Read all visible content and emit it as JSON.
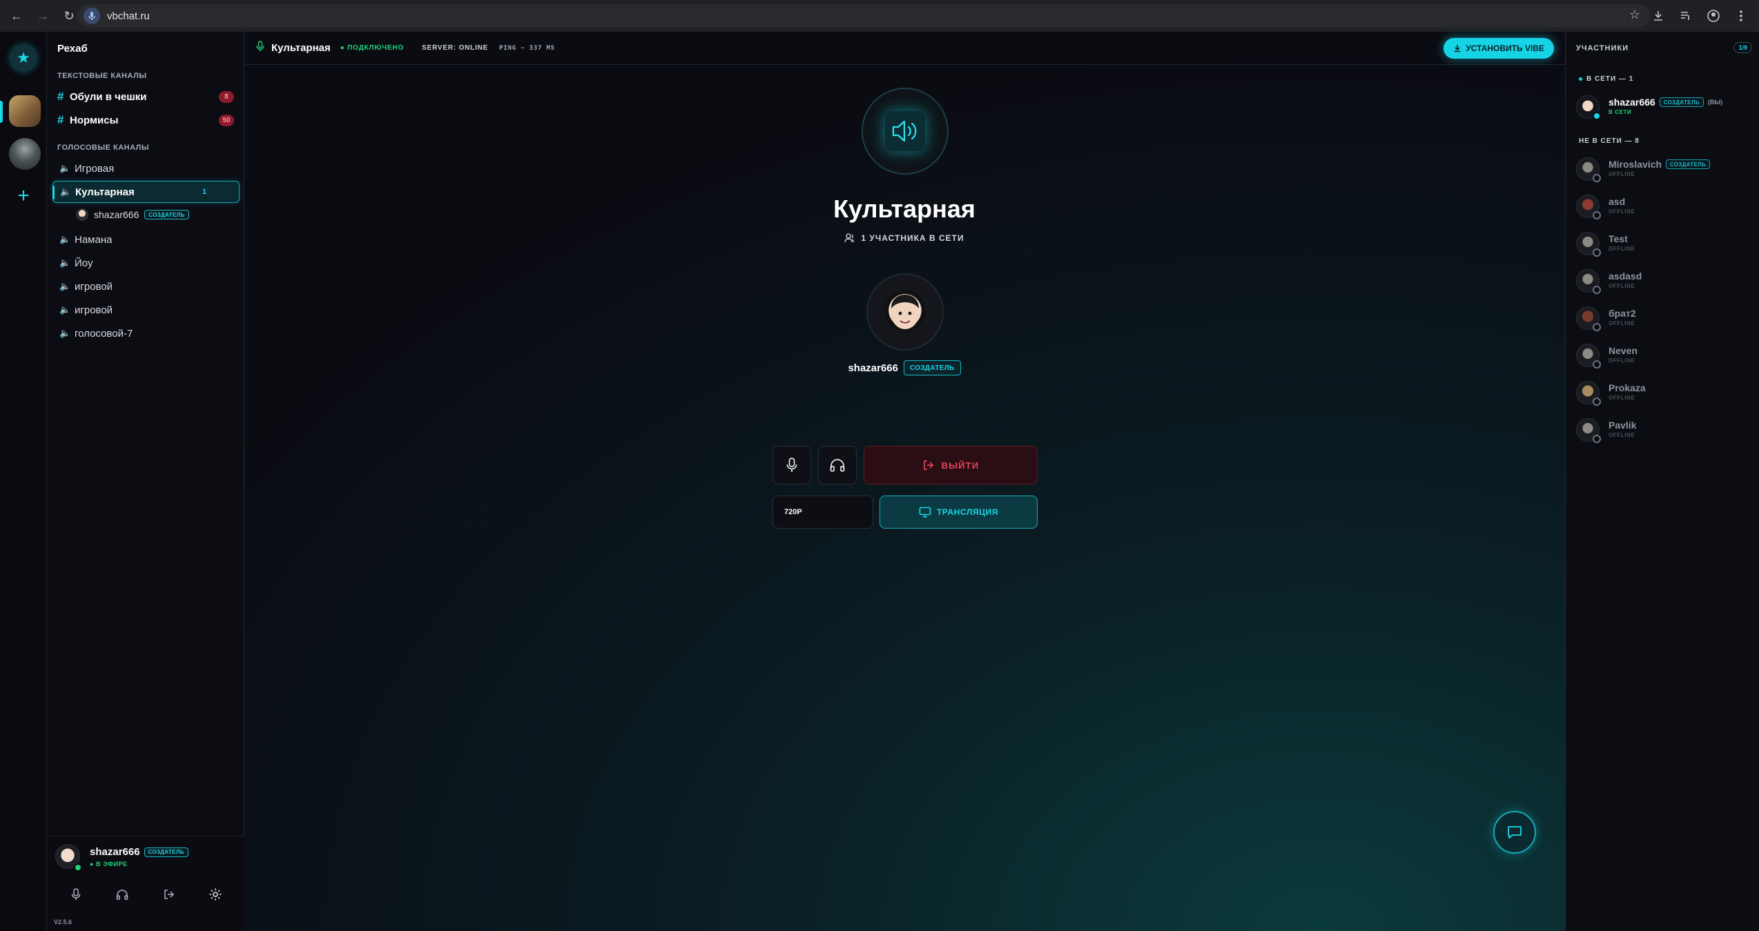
{
  "browser": {
    "url": "vbchat.ru"
  },
  "server": {
    "name": "Рехаб",
    "text_category": "ТЕКСТОВЫЕ КАНАЛЫ",
    "voice_category": "ГОЛОСОВЫЕ КАНАЛЫ",
    "text_channels": [
      {
        "name": "Обули в чешки",
        "unread": "8"
      },
      {
        "name": "Нормисы",
        "unread": "50"
      }
    ],
    "voice_channels": [
      {
        "name": "Игровая"
      },
      {
        "name": "Культарная",
        "count": "1"
      },
      {
        "name": "Намана"
      },
      {
        "name": "Йоу"
      },
      {
        "name": "игровой"
      },
      {
        "name": "игровой"
      },
      {
        "name": "голосовой-7"
      }
    ],
    "voice_member": {
      "name": "shazar666",
      "tag": "СОЗДАТЕЛЬ"
    }
  },
  "user_panel": {
    "name": "shazar666",
    "tag": "СОЗДАТЕЛЬ",
    "status": "● В ЭФИРЕ",
    "version": "V2.5.6"
  },
  "topbar": {
    "channel": "Культарная",
    "connection": "● ПОДКЛЮЧЕНО",
    "server_status": "SERVER: ONLINE",
    "ping": "PING ~ 337 MS",
    "install_label": "УСТАНОВИТЬ VIBE"
  },
  "room": {
    "title": "Культарная",
    "online": "1 УЧАСТНИКА В СЕТИ",
    "participant": {
      "name": "shazar666",
      "tag": "СОЗДАТЕЛЬ"
    },
    "exit_label": "ВЫЙТИ",
    "resolution": "720P",
    "stream_label": "ТРАНСЛЯЦИЯ"
  },
  "members": {
    "title": "УЧАСТНИКИ",
    "count": "1/9",
    "online_header": "В СЕТИ — 1",
    "offline_header": "НЕ В СЕТИ — 8",
    "online": [
      {
        "name": "shazar666",
        "tag": "СОЗДАТЕЛЬ",
        "you": "(ВЫ)",
        "status": "В СЕТИ"
      }
    ],
    "offline": [
      {
        "name": "Miroslavich",
        "tag": "СОЗДАТЕЛЬ",
        "status": "OFFLINE"
      },
      {
        "name": "asd",
        "status": "OFFLINE"
      },
      {
        "name": "Test",
        "status": "OFFLINE"
      },
      {
        "name": "asdasd",
        "status": "OFFLINE"
      },
      {
        "name": "брат2",
        "status": "OFFLINE"
      },
      {
        "name": "Neven",
        "status": "OFFLINE"
      },
      {
        "name": "Prokaza",
        "status": "OFFLINE"
      },
      {
        "name": "Pavlik",
        "status": "OFFLINE"
      }
    ]
  },
  "colors": {
    "accent": "#18d7e8",
    "online": "#22d37a",
    "danger": "#e2445a",
    "background": "#0b0a10"
  }
}
